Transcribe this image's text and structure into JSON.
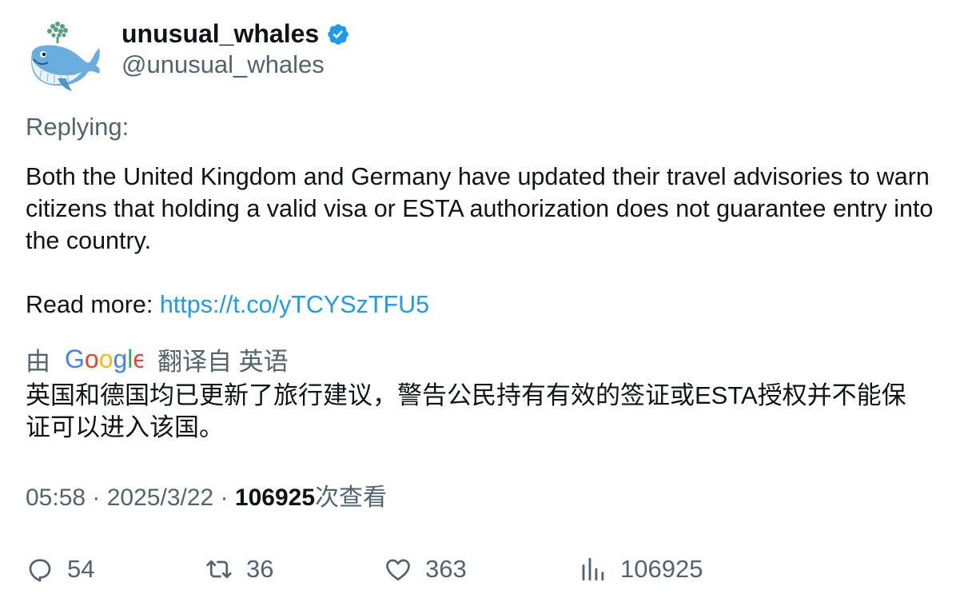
{
  "author": {
    "display_name": "unusual_whales",
    "handle": "@unusual_whales",
    "verified": true,
    "avatar_icon": "whale-avatar-icon",
    "verified_color": "#1d9bf0"
  },
  "replying_label": "Replying:",
  "tweet": {
    "line1": "Both the United Kingdom and Germany have updated their travel advisories to warn citizens that holding a valid visa or ESTA authorization does not guarantee entry into the country.",
    "read_more_label": "Read more: ",
    "link_text": "https://t.co/yTCYSzTFU5"
  },
  "translation": {
    "by_prefix": "由",
    "provider": "Google",
    "from_label": "翻译自 英语",
    "text": "英国和德国均已更新了旅行建议，警告公民持有有效的签证或ESTA授权并不能保证可以进入该国。"
  },
  "meta": {
    "time": "05:58",
    "separator": " · ",
    "date": "2025/3/22",
    "views_count": "106925",
    "views_label": "次查看"
  },
  "actions": {
    "reply_count": "54",
    "retweet_count": "36",
    "like_count": "363",
    "views_count": "106925"
  },
  "colors": {
    "text_primary": "#0f1419",
    "text_secondary": "#536471",
    "link": "#1d9bf0"
  }
}
